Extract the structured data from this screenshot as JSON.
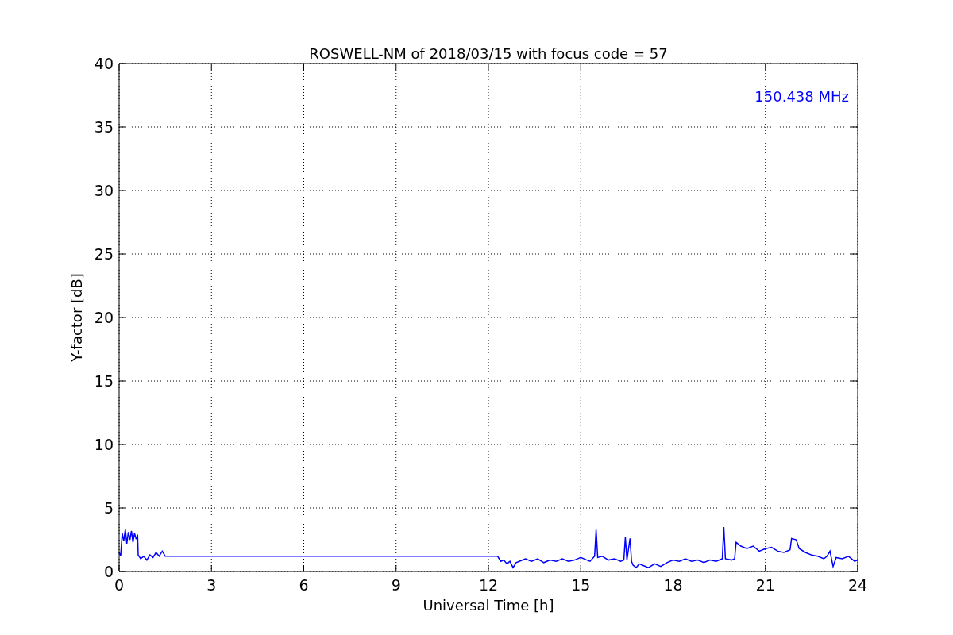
{
  "figure": {
    "chart_data": {
      "type": "line",
      "title": "ROSWELL-NM of 2018/03/15 with focus code = 57",
      "xlabel": "Universal Time [h]",
      "ylabel": "Y-factor [dB]",
      "x": [
        0,
        0.05,
        0.1,
        0.15,
        0.2,
        0.25,
        0.3,
        0.35,
        0.4,
        0.45,
        0.5,
        0.55,
        0.6,
        0.62,
        0.7,
        0.8,
        0.9,
        1.0,
        1.1,
        1.2,
        1.3,
        1.4,
        1.5,
        3,
        6,
        9,
        12.3,
        12.4,
        12.5,
        12.6,
        12.7,
        12.8,
        12.9,
        13.0,
        13.2,
        13.4,
        13.6,
        13.8,
        14.0,
        14.2,
        14.4,
        14.6,
        14.8,
        15.0,
        15.2,
        15.3,
        15.45,
        15.5,
        15.55,
        15.7,
        15.9,
        16.1,
        16.3,
        16.4,
        16.45,
        16.5,
        16.6,
        16.65,
        16.7,
        16.8,
        16.9,
        17.0,
        17.2,
        17.4,
        17.6,
        17.8,
        18.0,
        18.2,
        18.4,
        18.6,
        18.8,
        19.0,
        19.2,
        19.4,
        19.6,
        19.65,
        19.7,
        19.9,
        20.0,
        20.05,
        20.2,
        20.4,
        20.6,
        20.8,
        21.0,
        21.2,
        21.4,
        21.6,
        21.8,
        21.85,
        22.0,
        22.1,
        22.3,
        22.5,
        22.7,
        22.9,
        23.0,
        23.1,
        23.2,
        23.3,
        23.5,
        23.7,
        23.9,
        24
      ],
      "series": [
        {
          "name": "150.438 MHz",
          "color": "#0000ff",
          "values": [
            1.5,
            1.2,
            3.0,
            2.4,
            3.3,
            2.2,
            3.1,
            2.5,
            3.2,
            2.3,
            3.0,
            2.6,
            2.8,
            1.3,
            1.0,
            1.2,
            0.9,
            1.3,
            1.1,
            1.5,
            1.2,
            1.6,
            1.2,
            1.2,
            1.2,
            1.2,
            1.2,
            0.8,
            0.9,
            0.6,
            0.8,
            0.3,
            0.7,
            0.8,
            1.0,
            0.8,
            1.0,
            0.7,
            0.9,
            0.8,
            1.0,
            0.8,
            0.9,
            1.1,
            0.9,
            0.8,
            1.2,
            3.3,
            1.1,
            1.2,
            0.9,
            1.0,
            0.8,
            0.9,
            2.7,
            0.9,
            2.6,
            0.8,
            0.5,
            0.3,
            0.6,
            0.5,
            0.3,
            0.6,
            0.4,
            0.7,
            0.9,
            0.8,
            1.0,
            0.8,
            0.9,
            0.7,
            0.9,
            0.8,
            1.0,
            3.5,
            1.0,
            0.9,
            1.0,
            2.3,
            2.0,
            1.8,
            2.0,
            1.6,
            1.8,
            1.9,
            1.6,
            1.5,
            1.7,
            2.6,
            2.5,
            1.8,
            1.5,
            1.3,
            1.2,
            1.0,
            1.2,
            1.6,
            0.4,
            1.1,
            1.0,
            1.2,
            0.8,
            0.9
          ]
        }
      ],
      "xlim": [
        0,
        24
      ],
      "ylim": [
        0,
        40
      ],
      "xticks": [
        0,
        3,
        6,
        9,
        12,
        15,
        18,
        21,
        24
      ],
      "yticks": [
        0,
        5,
        10,
        15,
        20,
        25,
        30,
        35,
        40
      ],
      "grid": true
    }
  }
}
